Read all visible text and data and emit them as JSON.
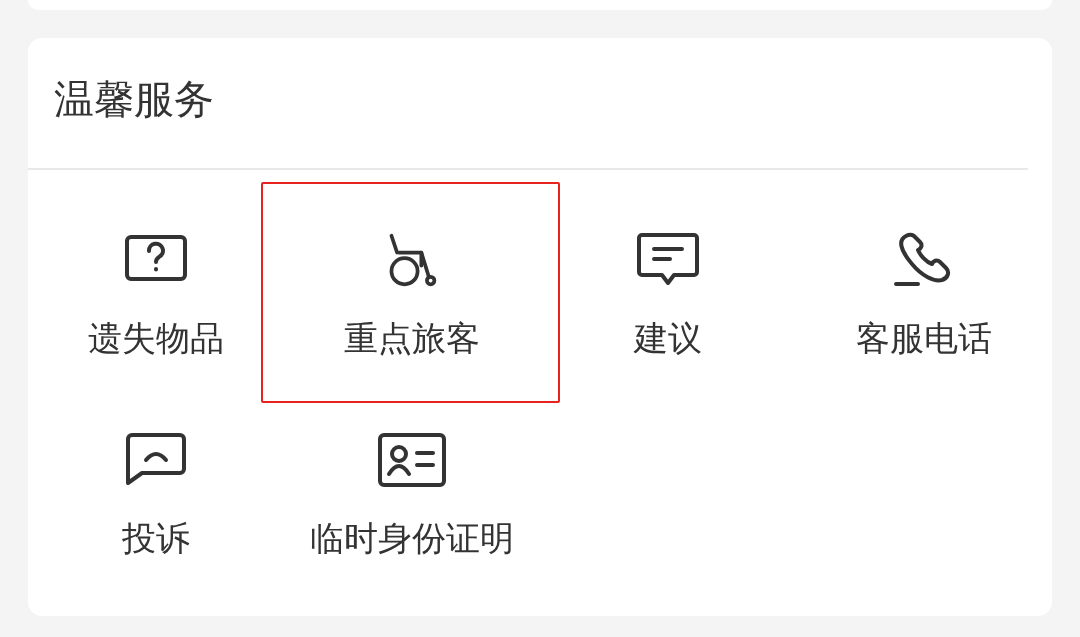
{
  "services": {
    "title": "温馨服务",
    "items": [
      {
        "kind": "lost",
        "label": "遗失物品",
        "highlighted": false
      },
      {
        "kind": "wheelchair",
        "label": "重点旅客",
        "highlighted": true
      },
      {
        "kind": "suggest",
        "label": "建议",
        "highlighted": false
      },
      {
        "kind": "phone",
        "label": "客服电话",
        "highlighted": false
      },
      {
        "kind": "complaint",
        "label": "投诉",
        "highlighted": false
      },
      {
        "kind": "idcard",
        "label": "临时身份证明",
        "highlighted": false
      }
    ]
  }
}
